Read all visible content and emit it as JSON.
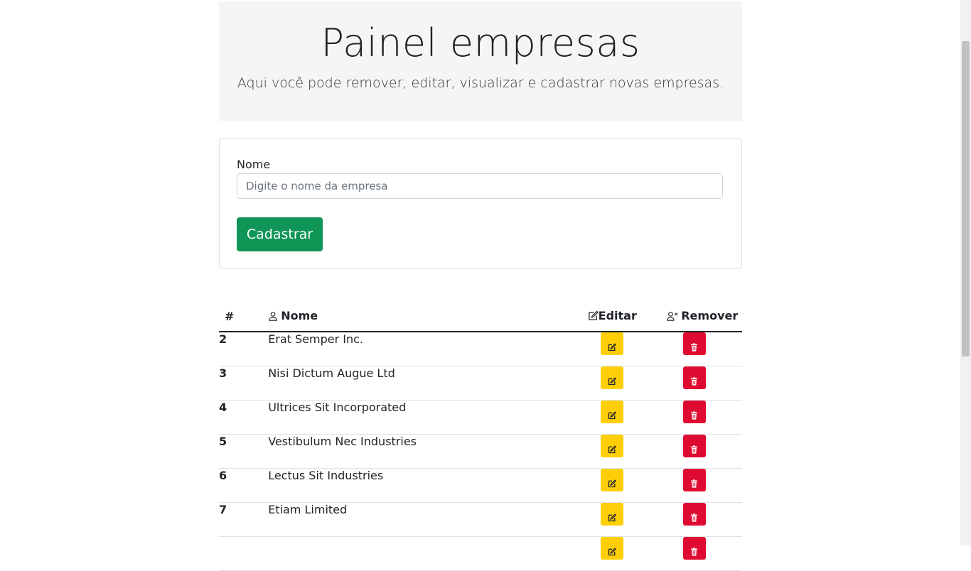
{
  "jumbotron": {
    "title": "Painel empresas",
    "lead": "Aqui você pode remover, editar, visualizar e cadastrar novas empresas."
  },
  "form": {
    "name_label": "Nome",
    "name_placeholder": "Digite o nome da empresa",
    "name_value": "",
    "submit_label": "Cadastrar"
  },
  "table": {
    "headers": {
      "id": "#",
      "name": "Nome",
      "edit": "Editar",
      "remove": "Remover"
    },
    "rows": [
      {
        "id": "2",
        "name": "Erat Semper Inc."
      },
      {
        "id": "3",
        "name": "Nisi Dictum Augue Ltd"
      },
      {
        "id": "4",
        "name": "Ultrices Sit Incorporated"
      },
      {
        "id": "5",
        "name": "Vestibulum Nec Industries"
      },
      {
        "id": "6",
        "name": "Lectus Sit Industries"
      },
      {
        "id": "7",
        "name": "Etiam Limited"
      },
      {
        "id": "",
        "name": ""
      }
    ]
  },
  "icons": {
    "header_name": "person-icon",
    "header_edit": "pencil-square-icon",
    "header_remove": "person-x-icon",
    "row_edit": "pencil-square-icon",
    "row_remove": "trash-icon"
  },
  "colors": {
    "primary_button": "#0f9656",
    "edit_button": "#fecf06",
    "remove_button": "#df0a32",
    "jumbotron_bg": "#f5f5f6"
  }
}
